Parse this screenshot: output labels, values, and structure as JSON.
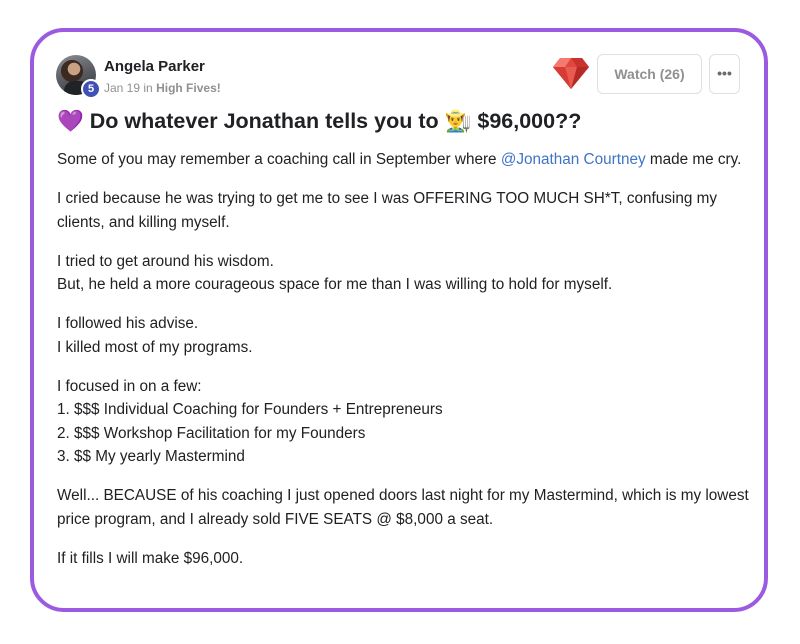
{
  "author": {
    "name": "Angela Parker",
    "level": "5",
    "date": "Jan 19",
    "in_word": "in",
    "group": "High Fives!"
  },
  "actions": {
    "gem_icon": "ruby-gem-icon",
    "watch_label": "Watch (26)",
    "more_label": "•••"
  },
  "post": {
    "title_emoji_start": "💜",
    "title_text": "Do whatever Jonathan tells you to",
    "title_emoji_mid": "👨‍🌾",
    "title_amount": "$96,000??",
    "p1_before": "Some of you may remember a coaching call in September where ",
    "p1_mention": "@Jonathan Courtney",
    "p1_after": " made me cry.",
    "p2": "I cried because he was trying to get me to see I was OFFERING TOO MUCH SH*T, confusing my clients, and killing myself.",
    "p3_lines": [
      "I tried to get around his wisdom.",
      "But, he held a more courageous space for me than I was willing to hold for myself."
    ],
    "p4_lines": [
      "I followed his advise.",
      "I killed most of my programs."
    ],
    "p5_lines": [
      "I focused in on a few:",
      "1. $$$ Individual Coaching for Founders + Entrepreneurs",
      "2. $$$ Workshop Facilitation for my Founders",
      "3. $$ My yearly Mastermind"
    ],
    "p6": "Well... BECAUSE of his coaching I just opened doors last night for my Mastermind, which is my lowest price program, and I already sold FIVE SEATS @ $8,000 a seat.",
    "p7": "If it fills I will make $96,000."
  },
  "colors": {
    "card_border": "#9b5ae0",
    "mention": "#3f74c4",
    "level_badge": "#3f51b5"
  }
}
